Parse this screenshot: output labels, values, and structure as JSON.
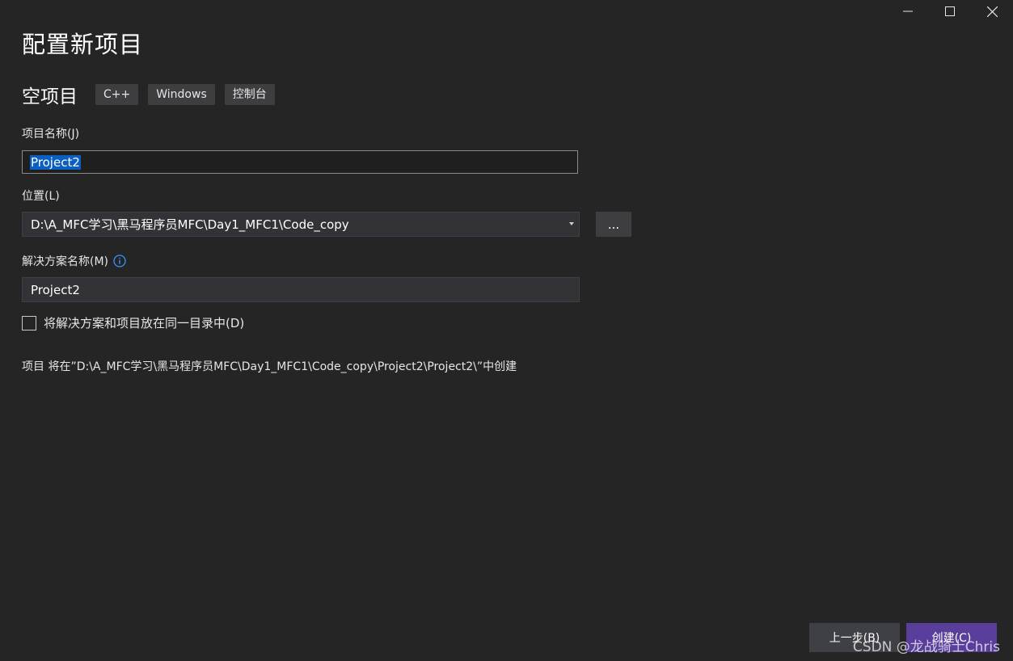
{
  "window": {
    "controls": [
      "minimize",
      "maximize",
      "close"
    ]
  },
  "page_title": "配置新项目",
  "template": {
    "name": "空项目",
    "tags": [
      "C++",
      "Windows",
      "控制台"
    ]
  },
  "project_name": {
    "label": "项目名称(J)",
    "value": "Project2"
  },
  "location": {
    "label": "位置(L)",
    "value": "D:\\A_MFC学习\\黑马程序员MFC\\Day1_MFC1\\Code_copy",
    "browse_label": "..."
  },
  "solution_name": {
    "label": "解决方案名称(M)",
    "value": "Project2"
  },
  "same_dir_checkbox": {
    "label": "将解决方案和项目放在同一目录中(D)",
    "checked": false
  },
  "create_path_text": "项目 将在”D:\\A_MFC学习\\黑马程序员MFC\\Day1_MFC1\\Code_copy\\Project2\\Project2\\”中创建",
  "footer": {
    "back_label": "上一步(B)",
    "create_label": "创建(C)"
  },
  "watermark": "CSDN @龙战骑士Chris",
  "colors": {
    "background": "#252526",
    "accent": "#5a3e9c",
    "selection": "#0b5fc1",
    "info": "#3794ff"
  }
}
